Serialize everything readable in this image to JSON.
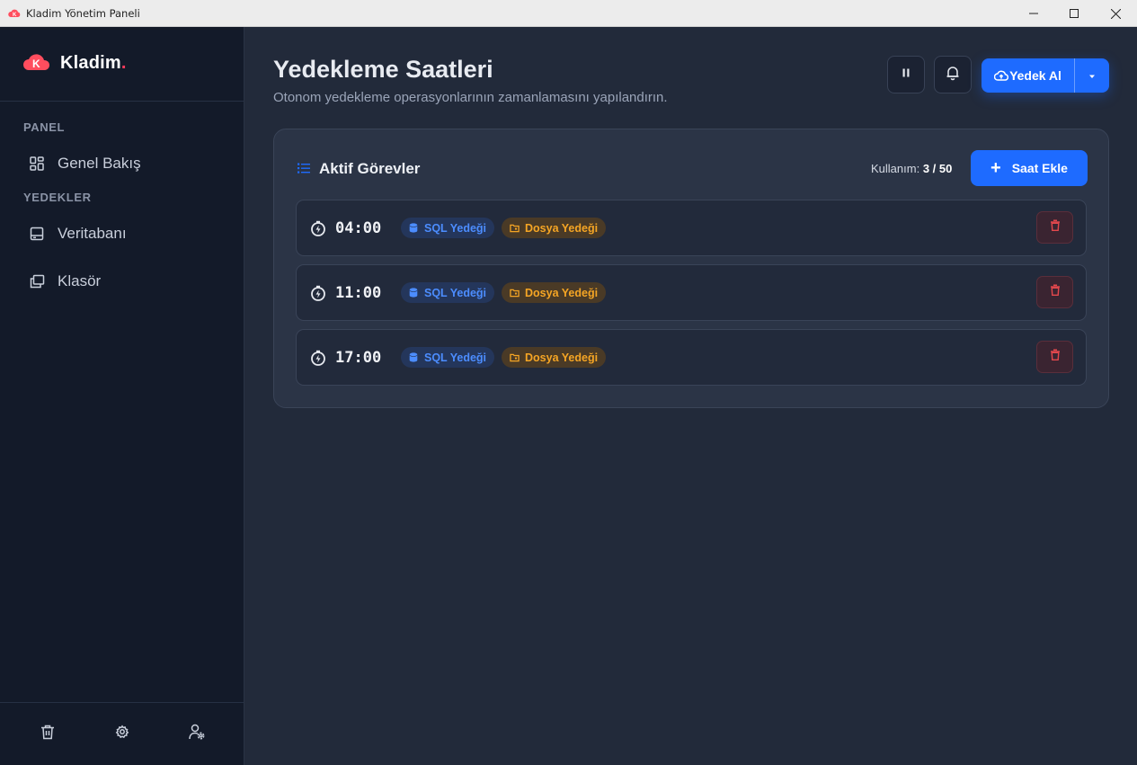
{
  "window": {
    "title": "Kladim Yönetim Paneli"
  },
  "brand": {
    "name": "Kladim",
    "dot": ".",
    "accent": "#ff3b5c"
  },
  "sidebar": {
    "sections": [
      {
        "label": "PANEL"
      },
      {
        "label": "YEDEKLER"
      }
    ],
    "items": [
      {
        "label": "Genel Bakış",
        "icon": "dashboard-grid-icon"
      },
      {
        "label": "Veritabanı",
        "icon": "database-drive-icon"
      },
      {
        "label": "Klasör",
        "icon": "folder-copy-icon"
      }
    ],
    "footer": [
      "trash-icon",
      "gear-icon",
      "user-settings-icon"
    ]
  },
  "header": {
    "title": "Yedekleme Saatleri",
    "subtitle": "Otonom yedekleme operasyonlarının zamanlamasını yapılandırın.",
    "backup_button": "Yedek Al",
    "accent": "#1e6bff"
  },
  "card": {
    "title": "Aktif Görevler",
    "usage_label": "Kullanım:",
    "usage_value": "3 / 50",
    "add_button": "Saat Ekle",
    "tasks": [
      {
        "time": "04:00",
        "tags": [
          "SQL Yedeği",
          "Dosya Yedeği"
        ]
      },
      {
        "time": "11:00",
        "tags": [
          "SQL Yedeği",
          "Dosya Yedeği"
        ]
      },
      {
        "time": "17:00",
        "tags": [
          "SQL Yedeği",
          "Dosya Yedeği"
        ]
      }
    ]
  }
}
